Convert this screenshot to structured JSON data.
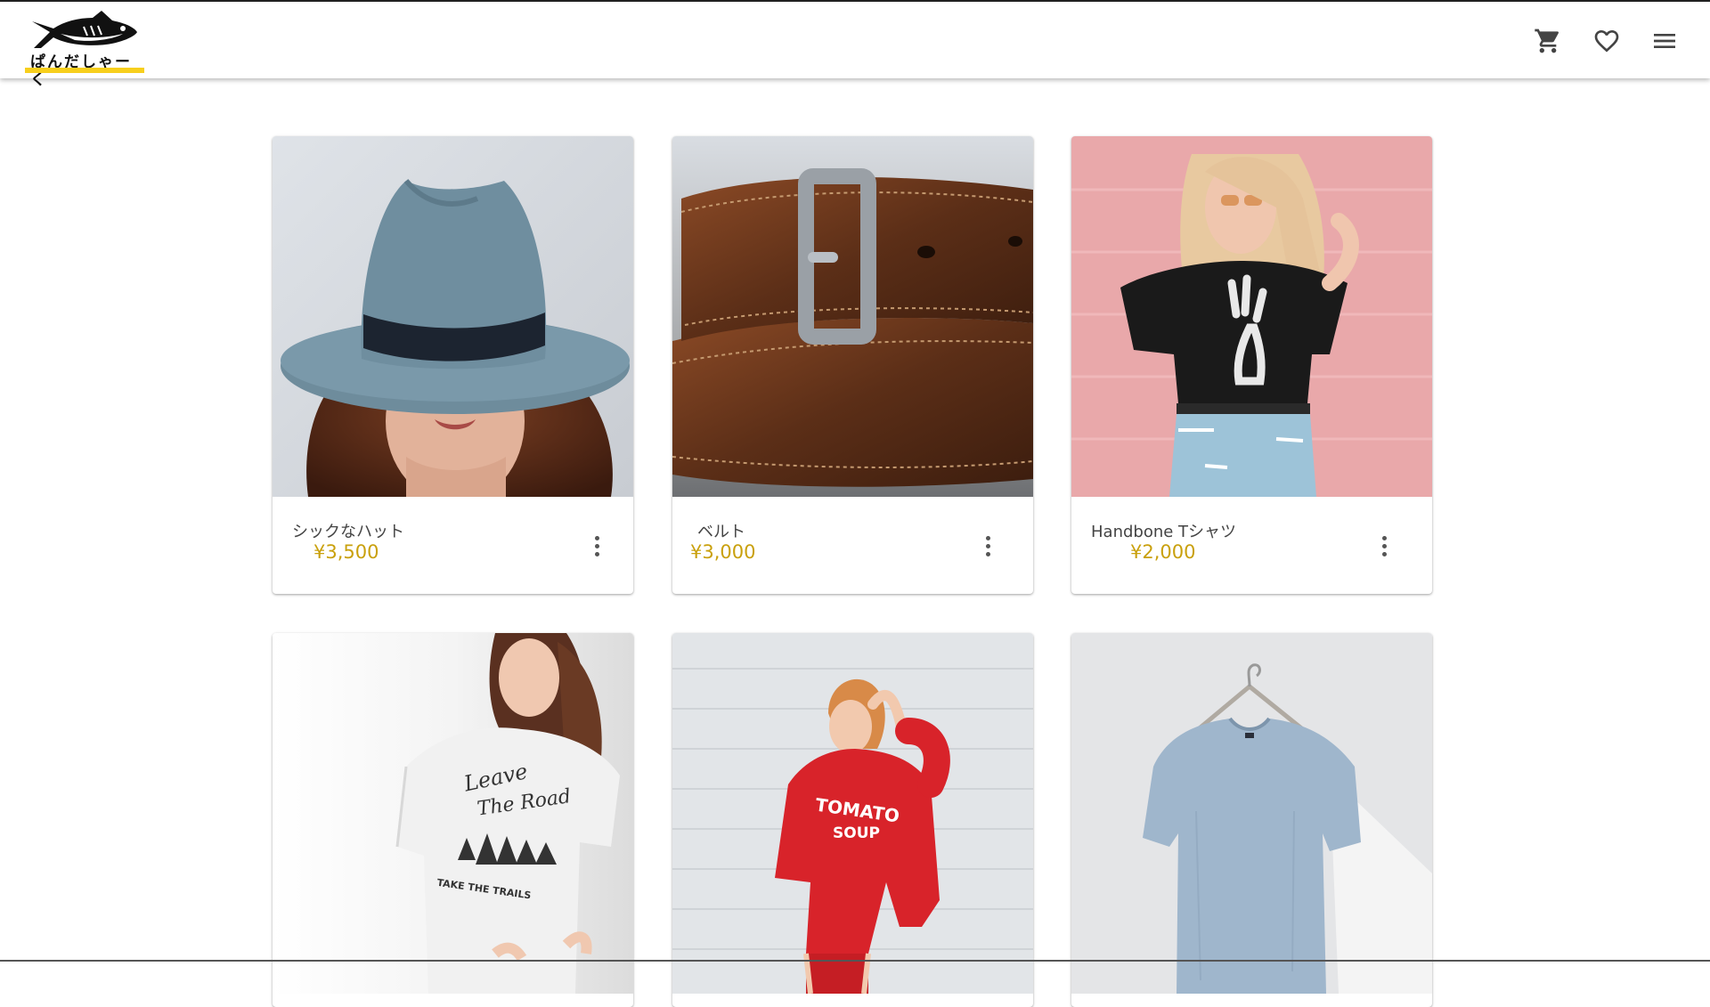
{
  "header": {
    "logo_text": "ぱんだしゃーく",
    "cart_icon": "cart-icon",
    "favorite_icon": "heart-icon",
    "menu_icon": "menu-icon"
  },
  "products": [
    {
      "name": "シックなハット",
      "price": "¥3,500",
      "image": "woman wearing blue-gray fedora hat"
    },
    {
      "name": "ベルト",
      "price": "¥3,000",
      "image": "brown leather belt with metal buckle"
    },
    {
      "name": "Handbone Tシャツ",
      "price": "¥2,000",
      "image": "woman in black skeleton-hand t-shirt against pink wall"
    },
    {
      "image": "woman in white t-shirt"
    },
    {
      "image": "woman in red sweatshirt"
    },
    {
      "image": "blue-gray t-shirt on hanger"
    }
  ],
  "print_text": {
    "shirt1_line1": "Leave",
    "shirt1_line2": "The Road",
    "shirt1_line3": "TAKE THE TRAILS",
    "sweat_line1": "TOMATO",
    "sweat_line2": "SOUP"
  },
  "colors": {
    "price": "#c9a00c",
    "logo_accent": "#f7cf1d",
    "icon": "#444444"
  }
}
